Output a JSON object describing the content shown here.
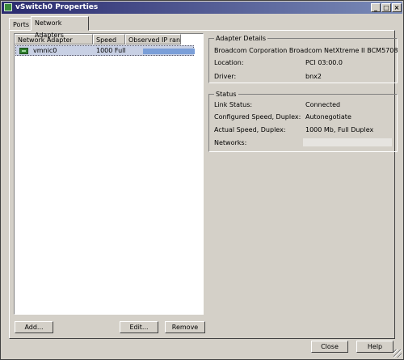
{
  "window": {
    "title": "vSwitch0 Properties"
  },
  "titlebar_buttons": {
    "minimize": "_",
    "maximize": "□",
    "close": "×"
  },
  "tabs": [
    {
      "label": "Ports"
    },
    {
      "label": "Network Adapters",
      "active": true
    }
  ],
  "adapter_list": {
    "columns": [
      "Network Adapter",
      "Speed",
      "Observed IP ran..."
    ],
    "rows": [
      {
        "adapter": "vmnic0",
        "speed": "1000 Full",
        "observed_ip": ""
      }
    ]
  },
  "list_buttons": {
    "add": "Add...",
    "edit": "Edit...",
    "remove": "Remove"
  },
  "adapter_details": {
    "title": "Adapter Details",
    "name": "Broadcom Corporation Broadcom NetXtreme II BCM5708",
    "location_label": "Location:",
    "location_value": "PCI 03:00.0",
    "driver_label": "Driver:",
    "driver_value": "bnx2"
  },
  "status": {
    "title": "Status",
    "link_status_label": "Link Status:",
    "link_status_value": "Connected",
    "configured_speed_label": "Configured Speed, Duplex:",
    "configured_speed_value": "Autonegotiate",
    "actual_speed_label": "Actual Speed, Duplex:",
    "actual_speed_value": "1000 Mb, Full Duplex",
    "networks_label": "Networks:",
    "networks_value": ""
  },
  "footer_buttons": {
    "close": "Close",
    "help": "Help"
  },
  "colors": {
    "dialog_bg": "#d4d0c8",
    "titlebar_start": "#2a2a6e",
    "titlebar_end": "#7a8bb8",
    "selected_row": "#c8d0e4",
    "ip_bar": "#7b9fd8"
  },
  "icons": {
    "title": "vswitch-icon",
    "adapter": "network-card-icon"
  }
}
